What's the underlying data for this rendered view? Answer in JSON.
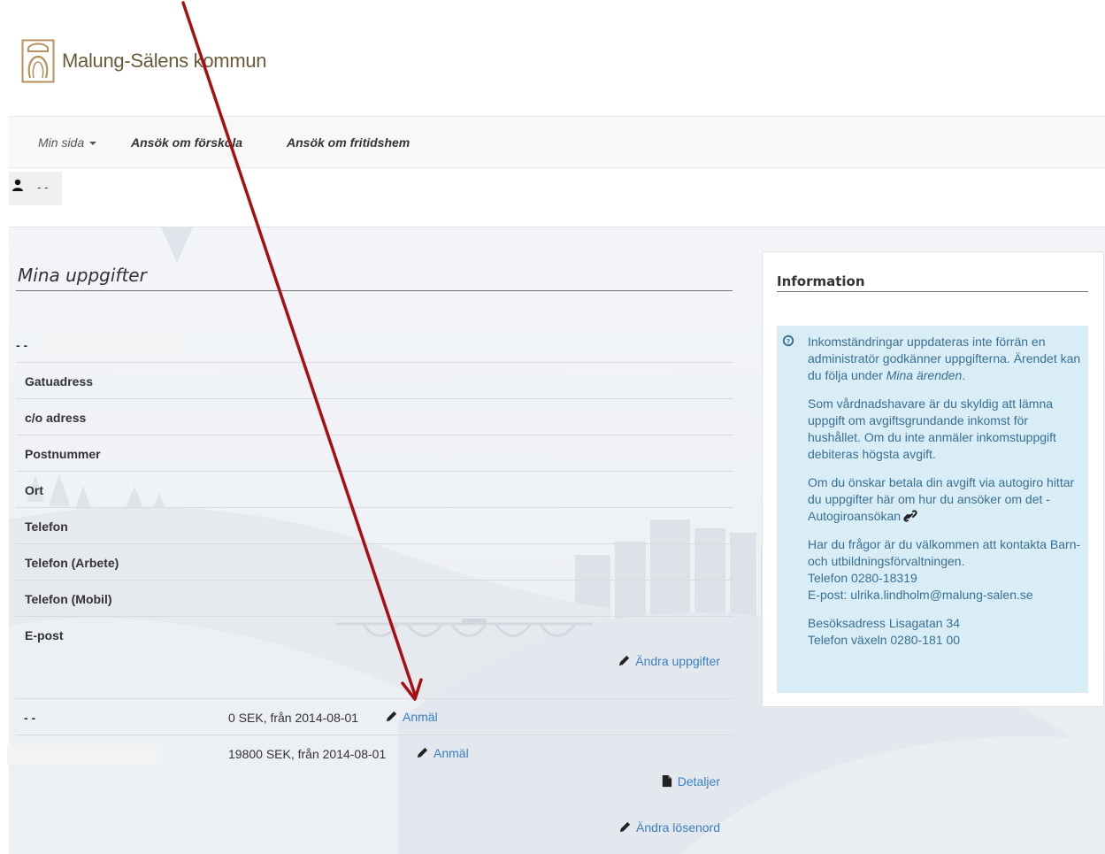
{
  "header": {
    "logo_text": "Malung-Sälens kommun"
  },
  "nav": {
    "min_sida": "Min sida",
    "forskola": "Ansök om förskola",
    "fritidshem": "Ansök om fritidshem"
  },
  "user": {
    "name": "- -"
  },
  "main": {
    "title": "Mina uppgifter",
    "person_name": "- -",
    "fields": [
      {
        "label": "Gatuadress"
      },
      {
        "label": "c/o adress"
      },
      {
        "label": "Postnummer"
      },
      {
        "label": "Ort"
      },
      {
        "label": "Telefon"
      },
      {
        "label": "Telefon (Arbete)"
      },
      {
        "label": "Telefon (Mobil)"
      },
      {
        "label": "E-post"
      }
    ],
    "edit_label": "Ändra uppgifter",
    "income": [
      {
        "name": "- -",
        "value": "0 SEK, från 2014-08-01",
        "action": "Anmäl"
      },
      {
        "name": "",
        "value": "19800 SEK, från 2014-08-01",
        "action": "Anmäl"
      }
    ],
    "details_label": "Detaljer",
    "change_password_label": "Ändra lösenord"
  },
  "info": {
    "heading": "Information",
    "p1a": "Inkomständringar uppdateras inte förrän en administratör godkänner uppgifterna. Ärendet kan du följa under ",
    "p1b": "Mina ärenden",
    "p1c": ".",
    "p2": "Som vårdnadshavare är du skyldig att lämna uppgift om avgiftsgrundande inkomst för hushållet. Om du inte anmäler inkomstuppgift debiteras högsta avgift.",
    "p3": "Om du önskar betala din avgift via autogiro hittar du uppgifter här om hur du ansöker om det - Autogiroansökan",
    "p4a": "Har du frågor är du välkommen att kontakta Barn- och utbildningsförvaltningen.",
    "p4b": "Telefon 0280-18319",
    "p4c": "E-post: ulrika.lindholm@malung-salen.se",
    "p5a": "Besöksadress Lisagatan 34",
    "p5b": "Telefon växeln 0280-181 00"
  },
  "colors": {
    "link": "#3a7ec2",
    "info_bg": "#d9edf7",
    "info_text": "#3a6f92",
    "arrow": "#a60f14",
    "logo": "#6b5a3a"
  },
  "icons": [
    "logo-crest-icon",
    "user-icon",
    "pencil-icon",
    "file-icon",
    "info-circle-icon",
    "link-icon",
    "annotation-arrow"
  ]
}
